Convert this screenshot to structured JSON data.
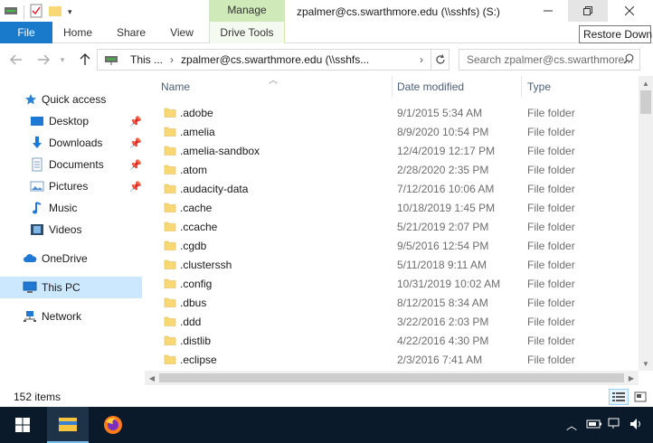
{
  "window": {
    "title": "zpalmer@cs.swarthmore.edu (\\\\sshfs) (S:)",
    "contextual_group": "Manage",
    "tooltip": "Restore Down"
  },
  "ribbon": {
    "tabs": [
      "File",
      "Home",
      "Share",
      "View",
      "Drive Tools"
    ]
  },
  "address": {
    "crumbs": [
      "This ...",
      "zpalmer@cs.swarthmore.edu (\\\\sshfs..."
    ],
    "search_placeholder": "Search zpalmer@cs.swarthmore..."
  },
  "nav": {
    "items": [
      "Quick access",
      "Desktop",
      "Downloads",
      "Documents",
      "Pictures",
      "Music",
      "Videos",
      "OneDrive",
      "This PC",
      "Network"
    ],
    "selected": "This PC"
  },
  "columns": {
    "name": "Name",
    "date": "Date modified",
    "type": "Type"
  },
  "files": [
    {
      "name": ".adobe",
      "date": "9/1/2015 5:34 AM",
      "type": "File folder"
    },
    {
      "name": ".amelia",
      "date": "8/9/2020 10:54 PM",
      "type": "File folder"
    },
    {
      "name": ".amelia-sandbox",
      "date": "12/4/2019 12:17 PM",
      "type": "File folder"
    },
    {
      "name": ".atom",
      "date": "2/28/2020 2:35 PM",
      "type": "File folder"
    },
    {
      "name": ".audacity-data",
      "date": "7/12/2016 10:06 AM",
      "type": "File folder"
    },
    {
      "name": ".cache",
      "date": "10/18/2019 1:45 PM",
      "type": "File folder"
    },
    {
      "name": ".ccache",
      "date": "5/21/2019 2:07 PM",
      "type": "File folder"
    },
    {
      "name": ".cgdb",
      "date": "9/5/2016 12:54 PM",
      "type": "File folder"
    },
    {
      "name": ".clusterssh",
      "date": "5/11/2018 9:11 AM",
      "type": "File folder"
    },
    {
      "name": ".config",
      "date": "10/31/2019 10:02 AM",
      "type": "File folder"
    },
    {
      "name": ".dbus",
      "date": "8/12/2015 8:34 AM",
      "type": "File folder"
    },
    {
      "name": ".ddd",
      "date": "3/22/2016 2:03 PM",
      "type": "File folder"
    },
    {
      "name": ".distlib",
      "date": "4/22/2016 4:30 PM",
      "type": "File folder"
    },
    {
      "name": ".eclipse",
      "date": "2/3/2016 7:41 AM",
      "type": "File folder"
    }
  ],
  "status": {
    "item_count": "152 items"
  },
  "colors": {
    "file_tab": "#1979ca",
    "manage": "#cfe9b8",
    "selection": "#cce8ff",
    "folder": "#f8d775",
    "taskbar": "#0b1a2a"
  }
}
